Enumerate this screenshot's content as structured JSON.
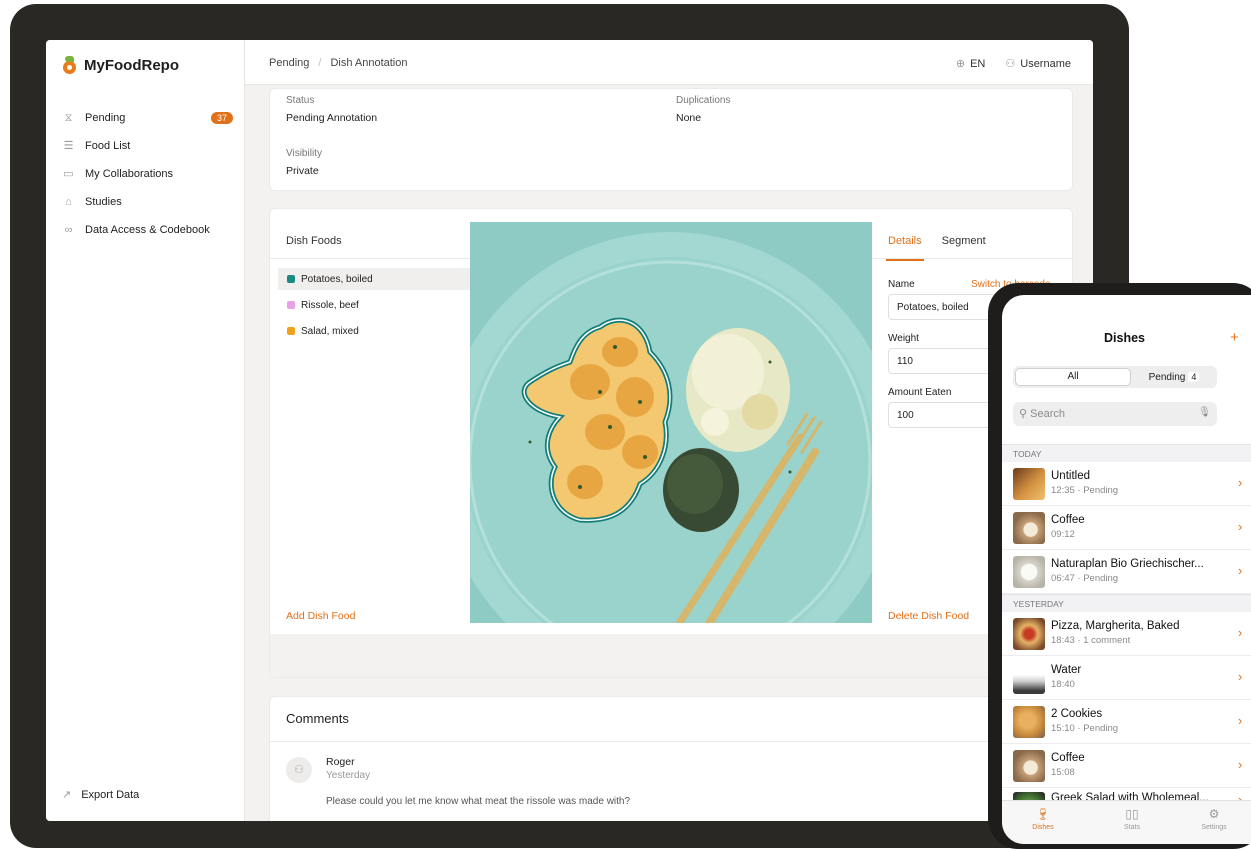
{
  "app": {
    "name": "MyFoodRepo"
  },
  "sidebar": {
    "items": [
      {
        "label": "Pending",
        "icon": "hourglass-icon",
        "badge": "37"
      },
      {
        "label": "Food List",
        "icon": "list-icon"
      },
      {
        "label": "My Collaborations",
        "icon": "folder-icon"
      },
      {
        "label": "Studies",
        "icon": "graduation-cap-icon"
      },
      {
        "label": "Data Access & Codebook",
        "icon": "share-nodes-icon"
      }
    ],
    "export_label": "Export Data"
  },
  "header": {
    "breadcrumb": [
      "Pending",
      "Dish Annotation"
    ],
    "language": "EN",
    "username": "Username"
  },
  "status_card": {
    "status_label": "Status",
    "status_value": "Pending Annotation",
    "duplications_label": "Duplications",
    "duplications_value": "None",
    "visibility_label": "Visibility",
    "visibility_value": "Private"
  },
  "dish_foods": {
    "title": "Dish Foods",
    "items": [
      {
        "label": "Potatoes, boiled",
        "color": "#1a8a83"
      },
      {
        "label": "Rissole, beef",
        "color": "#e9a0e6"
      },
      {
        "label": "Salad, mixed",
        "color": "#f0a21c"
      }
    ],
    "add_label": "Add Dish Food"
  },
  "details": {
    "tabs": [
      "Details",
      "Segment"
    ],
    "name_label": "Name",
    "name_value": "Potatoes, boiled",
    "switch_label": "Switch to barcode",
    "weight_label": "Weight",
    "weight_value": "110",
    "amount_label": "Amount Eaten",
    "amount_value": "100",
    "delete_label": "Delete Dish Food"
  },
  "comments": {
    "title": "Comments",
    "items": [
      {
        "author": "Roger",
        "time": "Yesterday",
        "text": "Please could you let me know what meat the rissole was made with?"
      }
    ]
  },
  "phone": {
    "title": "Dishes",
    "add_label": "+",
    "segments": {
      "all": "All",
      "pending": "Pending",
      "pending_count": "4"
    },
    "search_placeholder": "Search",
    "sections": {
      "today": "TODAY",
      "yesterday": "YESTERDAY"
    },
    "today": [
      {
        "title": "Untitled",
        "subtitle": "12:35 · Pending"
      },
      {
        "title": "Coffee",
        "subtitle": "09:12"
      },
      {
        "title": "Naturaplan Bio Griechischer...",
        "subtitle": "06:47 · Pending"
      }
    ],
    "yesterday": [
      {
        "title": "Pizza, Margherita, Baked",
        "subtitle": "18:43 · 1 comment"
      },
      {
        "title": "Water",
        "subtitle": "18:40"
      },
      {
        "title": "2 Cookies",
        "subtitle": "15:10 · Pending"
      },
      {
        "title": "Coffee",
        "subtitle": "15:08"
      },
      {
        "title": "Greek Salad with Wholemeal...",
        "subtitle": ""
      }
    ],
    "tabs": [
      "Dishes",
      "Stats",
      "Settings"
    ]
  }
}
